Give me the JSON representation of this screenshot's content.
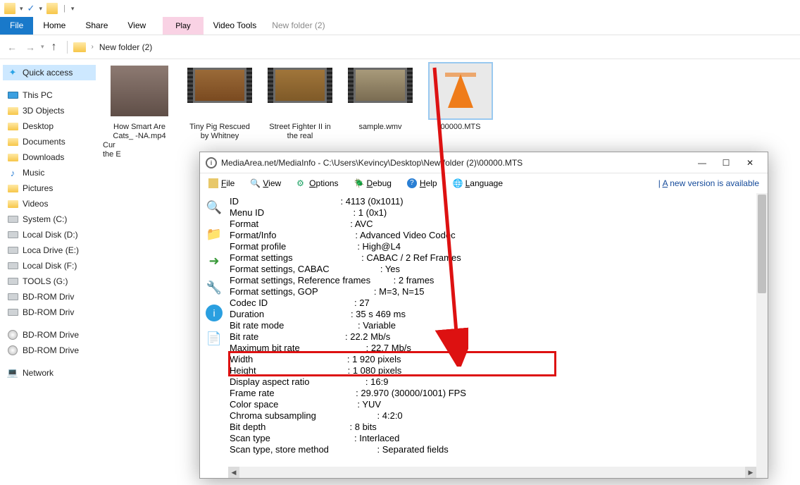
{
  "qat": {
    "dropdown": "▾"
  },
  "ribbon": {
    "file": "File",
    "home": "Home",
    "share": "Share",
    "view": "View",
    "play_group": "Play",
    "video_tools": "Video Tools",
    "title": "New folder (2)"
  },
  "breadcrumb": {
    "text": "New folder (2)"
  },
  "sidebar": {
    "quick": "Quick access",
    "thispc": "This PC",
    "items": [
      "3D Objects",
      "Desktop",
      "Documents",
      "Downloads",
      "Music",
      "Pictures",
      "Videos",
      "System (C:)",
      "Local Disk (D:)",
      "Loca Drive (E:)",
      "Local Disk (F:)",
      "TOOLS (G:)",
      "BD-ROM Driv",
      "BD-ROM Driv"
    ],
    "discs": [
      "BD-ROM Drive",
      "BD-ROM Drive"
    ],
    "network": "Network"
  },
  "thumbs": [
    {
      "n": "How Smart Are Cats_ -NA.mp4",
      "n2": "Cur",
      "n3": "the E"
    },
    {
      "n": "Tiny Pig Rescued by Whitney"
    },
    {
      "n": "Street Fighter II in the real"
    },
    {
      "n": "sample.wmv"
    },
    {
      "n": "00000.MTS"
    }
  ],
  "mediainfo": {
    "title": "MediaArea.net/MediaInfo - C:\\Users\\Kevincy\\Desktop\\New folder (2)\\00000.MTS",
    "menu": {
      "file": "File",
      "view": "View",
      "options": "Options",
      "debug": "Debug",
      "help": "Help",
      "lang": "Language",
      "ver": "A new version is available"
    },
    "rows": [
      {
        "k": "ID",
        "v": "4113 (0x1011)"
      },
      {
        "k": "Menu ID",
        "v": "1 (0x1)"
      },
      {
        "k": "Format",
        "v": "AVC"
      },
      {
        "k": "Format/Info",
        "v": "Advanced Video Codec"
      },
      {
        "k": "Format profile",
        "v": "High@L4"
      },
      {
        "k": "Format settings",
        "v": "CABAC / 2 Ref Frames"
      },
      {
        "k": "Format settings, CABAC",
        "v": "Yes"
      },
      {
        "k": "Format settings, Reference frames",
        "v": "2 frames"
      },
      {
        "k": "Format settings, GOP",
        "v": "M=3, N=15"
      },
      {
        "k": "Codec ID",
        "v": "27"
      },
      {
        "k": "Duration",
        "v": "35 s 469 ms"
      },
      {
        "k": "Bit rate mode",
        "v": "Variable"
      },
      {
        "k": "Bit rate",
        "v": "22.2 Mb/s"
      },
      {
        "k": "Maximum bit rate",
        "v": "22.7 Mb/s"
      },
      {
        "k": "Width",
        "v": "1 920 pixels"
      },
      {
        "k": "Height",
        "v": "1 080 pixels"
      },
      {
        "k": "Display aspect ratio",
        "v": "16:9"
      },
      {
        "k": "Frame rate",
        "v": "29.970 (30000/1001) FPS"
      },
      {
        "k": "Color space",
        "v": "YUV"
      },
      {
        "k": "Chroma subsampling",
        "v": "4:2:0"
      },
      {
        "k": "Bit depth",
        "v": "8 bits"
      },
      {
        "k": "Scan type",
        "v": "Interlaced"
      },
      {
        "k": "Scan type, store method",
        "v": "Separated fields"
      }
    ]
  }
}
